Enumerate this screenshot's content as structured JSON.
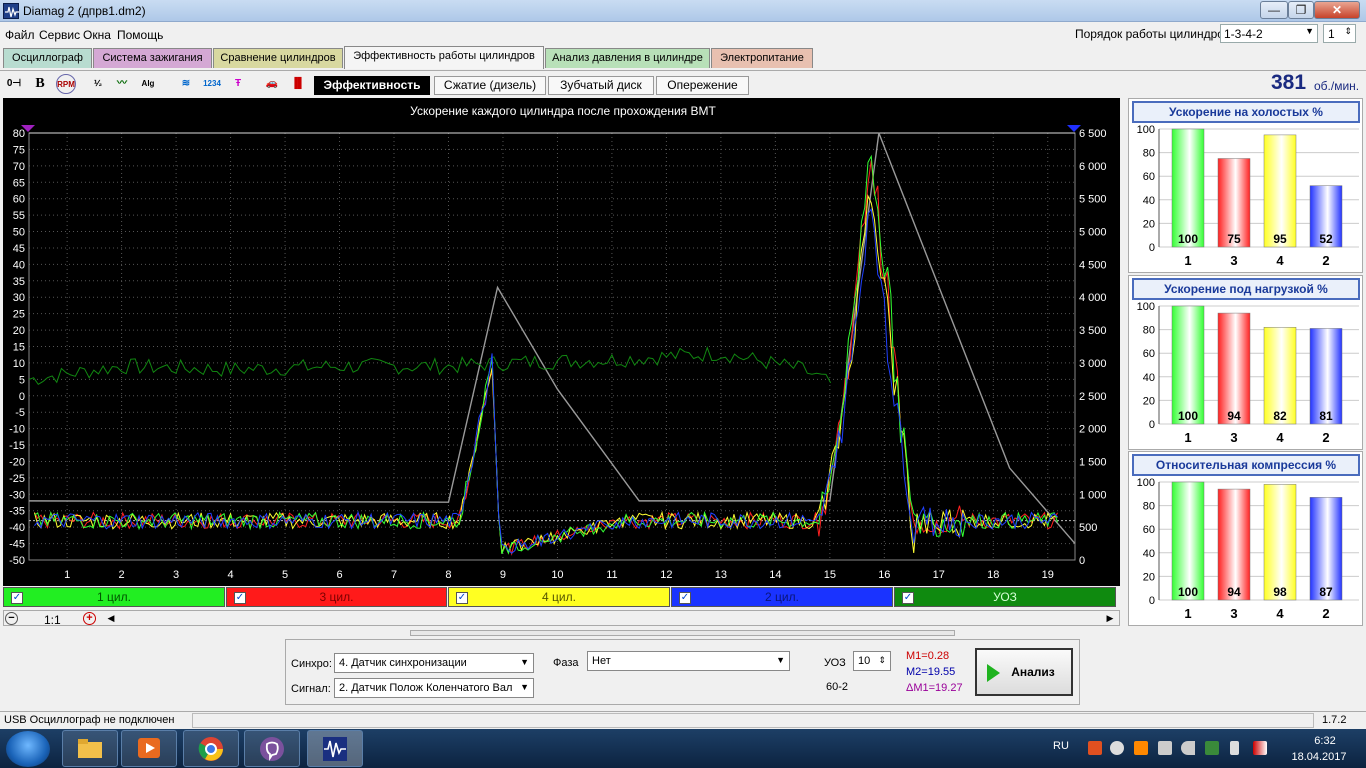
{
  "window": {
    "title": "Diamag 2 (дпрв1.dm2)",
    "min": "—",
    "max": "❐",
    "close": "✕"
  },
  "menu": [
    "Файл",
    "Сервис",
    "Окна",
    "Помощь"
  ],
  "cylinder_order": {
    "label": "Порядок работы цилиндров",
    "value": "1-3-4-2",
    "num": "1"
  },
  "tabs": [
    {
      "label": "Осциллограф",
      "color": "#b8dcd0"
    },
    {
      "label": "Система зажигания",
      "color": "#d4a8d4"
    },
    {
      "label": "Сравнение цилиндров",
      "color": "#d8d8a0"
    },
    {
      "label": "Эффективность работы цилиндров",
      "color": "#f5f5f5"
    },
    {
      "label": "Анализ давления в цилиндре",
      "color": "#b8e0b8"
    },
    {
      "label": "Электропитание",
      "color": "#e8c0b0"
    }
  ],
  "toolbar_icons": [
    "0⊣",
    "B",
    "RPM",
    "1/2",
    "~",
    "Alg",
    "wave",
    "1234",
    "T",
    "car",
    "bar"
  ],
  "subtabs": [
    "Эффективность",
    "Сжатие (дизель)",
    "Зубчатый диск",
    "Опережение"
  ],
  "rpm": {
    "value": "381",
    "unit": "об./мин."
  },
  "chart_data": {
    "type": "line",
    "title": "Ускорение каждого цилиндра после прохождения ВМТ",
    "y_left_ticks": [
      "80",
      "75",
      "70",
      "65",
      "60",
      "55",
      "50",
      "45",
      "40",
      "35",
      "30",
      "25",
      "20",
      "15",
      "10",
      "5",
      "0",
      "-5",
      "-10",
      "-15",
      "-20",
      "-25",
      "-30",
      "-35",
      "-40",
      "-45",
      "-50"
    ],
    "y_right_ticks": [
      "6 500",
      "6 000",
      "5 500",
      "5 000",
      "4 500",
      "4 000",
      "3 500",
      "3 000",
      "2 500",
      "2 000",
      "1 500",
      "1 000",
      "500",
      "0"
    ],
    "x_ticks": [
      "1",
      "2",
      "3",
      "4",
      "5",
      "6",
      "7",
      "8",
      "9",
      "10",
      "11",
      "12",
      "13",
      "14",
      "15",
      "16",
      "17",
      "18",
      "19"
    ],
    "ylim_left": [
      -50,
      80
    ],
    "ylim_right": [
      0,
      6500
    ],
    "xlim": [
      0.3,
      19.5
    ],
    "grid": true,
    "series": [
      {
        "name": "1 цил.",
        "color": "#33ff33"
      },
      {
        "name": "3 цил.",
        "color": "#ff2020"
      },
      {
        "name": "4 цил.",
        "color": "#ffff33"
      },
      {
        "name": "2 цил.",
        "color": "#2040ff"
      },
      {
        "name": "УОЗ",
        "color": "#118811"
      }
    ],
    "base_noise_level": -38,
    "rpm_trace": [
      [
        0.3,
        900
      ],
      [
        8.0,
        880
      ],
      [
        8.9,
        4150
      ],
      [
        10.0,
        2600
      ],
      [
        11.5,
        900
      ],
      [
        15.0,
        900
      ],
      [
        15.9,
        6500
      ],
      [
        18.3,
        1400
      ],
      [
        19.5,
        250
      ]
    ],
    "accel_peaks": [
      {
        "x": 8.8,
        "y": 10
      },
      {
        "x": 15.75,
        "y": 80
      }
    ],
    "uoz_trace": [
      [
        0.3,
        5
      ],
      [
        2,
        9
      ],
      [
        4,
        8
      ],
      [
        6,
        9
      ],
      [
        8,
        9
      ],
      [
        9,
        10
      ],
      [
        11,
        11
      ],
      [
        13,
        13
      ],
      [
        14.5,
        8
      ],
      [
        15.1,
        3
      ]
    ]
  },
  "legend": [
    {
      "label": "1 цил.",
      "bg": "#22ee22",
      "fg": "#005500"
    },
    {
      "label": "3 цил.",
      "bg": "#ff1a1a",
      "fg": "#7a0000"
    },
    {
      "label": "4 цил.",
      "bg": "#ffff22",
      "fg": "#555500"
    },
    {
      "label": "2 цил.",
      "bg": "#1a33ff",
      "fg": "#0a157a"
    },
    {
      "label": "УОЗ",
      "bg": "#0f8a0f",
      "fg": "#d6ffd6"
    }
  ],
  "zoom": {
    "label": "1:1"
  },
  "panels": [
    {
      "title": "Ускорение на холостых %",
      "bars": [
        {
          "cyl": "1",
          "value": 100,
          "label": "100",
          "color": "#33ff33"
        },
        {
          "cyl": "3",
          "value": 75,
          "label": "75",
          "color": "#ff2020"
        },
        {
          "cyl": "4",
          "value": 95,
          "label": "95",
          "color": "#ffff22"
        },
        {
          "cyl": "2",
          "value": 52,
          "label": "52",
          "color": "#2233ff"
        }
      ]
    },
    {
      "title": "Ускорение под нагрузкой %",
      "bars": [
        {
          "cyl": "1",
          "value": 100,
          "label": "100",
          "color": "#33ff33"
        },
        {
          "cyl": "3",
          "value": 94,
          "label": "94",
          "color": "#ff2020"
        },
        {
          "cyl": "4",
          "value": 82,
          "label": "82",
          "color": "#ffff22"
        },
        {
          "cyl": "2",
          "value": 81,
          "label": "81",
          "color": "#2233ff"
        }
      ]
    },
    {
      "title": "Относительная компрессия %",
      "bars": [
        {
          "cyl": "1",
          "value": 100,
          "label": "100",
          "color": "#33ff33"
        },
        {
          "cyl": "3",
          "value": 94,
          "label": "94",
          "color": "#ff2020"
        },
        {
          "cyl": "4",
          "value": 98,
          "label": "98",
          "color": "#ffff22"
        },
        {
          "cyl": "2",
          "value": 87,
          "label": "87",
          "color": "#2233ff"
        }
      ]
    }
  ],
  "panel_ticks": [
    "100",
    "80",
    "60",
    "40",
    "20",
    "0"
  ],
  "controls": {
    "sync_label": "Синхро:",
    "sync_value": "4.  Датчик синхронизации",
    "signal_label": "Сигнал:",
    "signal_value": "2.  Датчик Полож Коленчатого Вал",
    "phase_label": "Фаза",
    "phase_value": "Нет",
    "uoz_label": "УОЗ",
    "uoz_value": "10",
    "disk_label": "60-2",
    "m1": "M1=0.28",
    "m2": "M2=19.55",
    "dm1": "ΔM1=19.27",
    "analyze": "Анализ"
  },
  "status": {
    "text": "USB Осциллограф не подключен",
    "version": "1.7.2"
  },
  "taskbar": {
    "lang": "RU",
    "time": "6:32",
    "date": "18.04.2017"
  }
}
